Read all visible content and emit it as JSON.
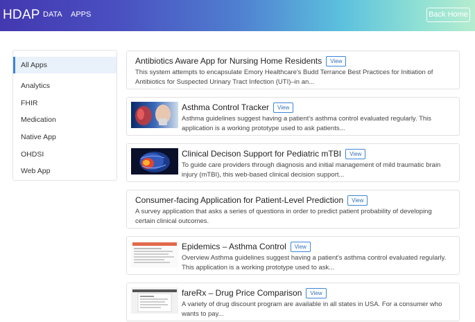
{
  "nav": {
    "brand": "HDAP",
    "links": [
      "DATA",
      "APPS"
    ],
    "back_label": "Back Home"
  },
  "sidebar": {
    "items": [
      {
        "label": "All Apps",
        "active": true
      },
      {
        "label": "Analytics"
      },
      {
        "label": "FHIR"
      },
      {
        "label": "Medication"
      },
      {
        "label": "Native App"
      },
      {
        "label": "OHDSI"
      },
      {
        "label": "Web App"
      }
    ]
  },
  "apps": [
    {
      "title": "Antibiotics Aware App for Nursing Home Residents",
      "view": "View",
      "desc_line1": "This system attempts to encapsulate Emory Healthcare's Budd Terrance Best Practices for Initiation of",
      "desc_line2": "Antibiotics for Suspected Urinary Tract Infection (UTI)–in an...",
      "thumbnail": null
    },
    {
      "title": "Asthma Control Tracker",
      "view": "View",
      "desc_line1": "Asthma guidelines suggest having a patient's asthma control evaluated regularly. This",
      "desc_line2": "application is a working prototype used to ask patients...",
      "thumbnail": "asthma-lungs-image"
    },
    {
      "title": "Clinical Decison Support for Pediatric mTBI",
      "view": "View",
      "desc_line1": "To guide care providers through diagnosis and initial management of mild traumatic brain",
      "desc_line2": "injury (mTBI), this web-based clinical decision support...",
      "thumbnail": "brain-scan-image"
    },
    {
      "title": "Consumer-facing Application for Patient-Level Prediction",
      "view": "View",
      "desc_line1": "A survey application that asks a series of questions in order to predict patient probability of developing",
      "desc_line2": "certain clinical outcomes.",
      "thumbnail": null
    },
    {
      "title": "Epidemics – Asthma Control",
      "view": "View",
      "desc_line1": "Overview Asthma guidelines suggest having a patient's asthma control evaluated regularly.",
      "desc_line2": "This application is a working prototype used to ask...",
      "thumbnail": "app-screenshot-image"
    },
    {
      "title": "fareRx – Drug Price Comparison",
      "view": "View",
      "desc_line1": "A variety of drug discount program are available in all states in USA. For a consumer who",
      "desc_line2": "wants to pay...",
      "thumbnail": "app-screenshot-image"
    }
  ]
}
